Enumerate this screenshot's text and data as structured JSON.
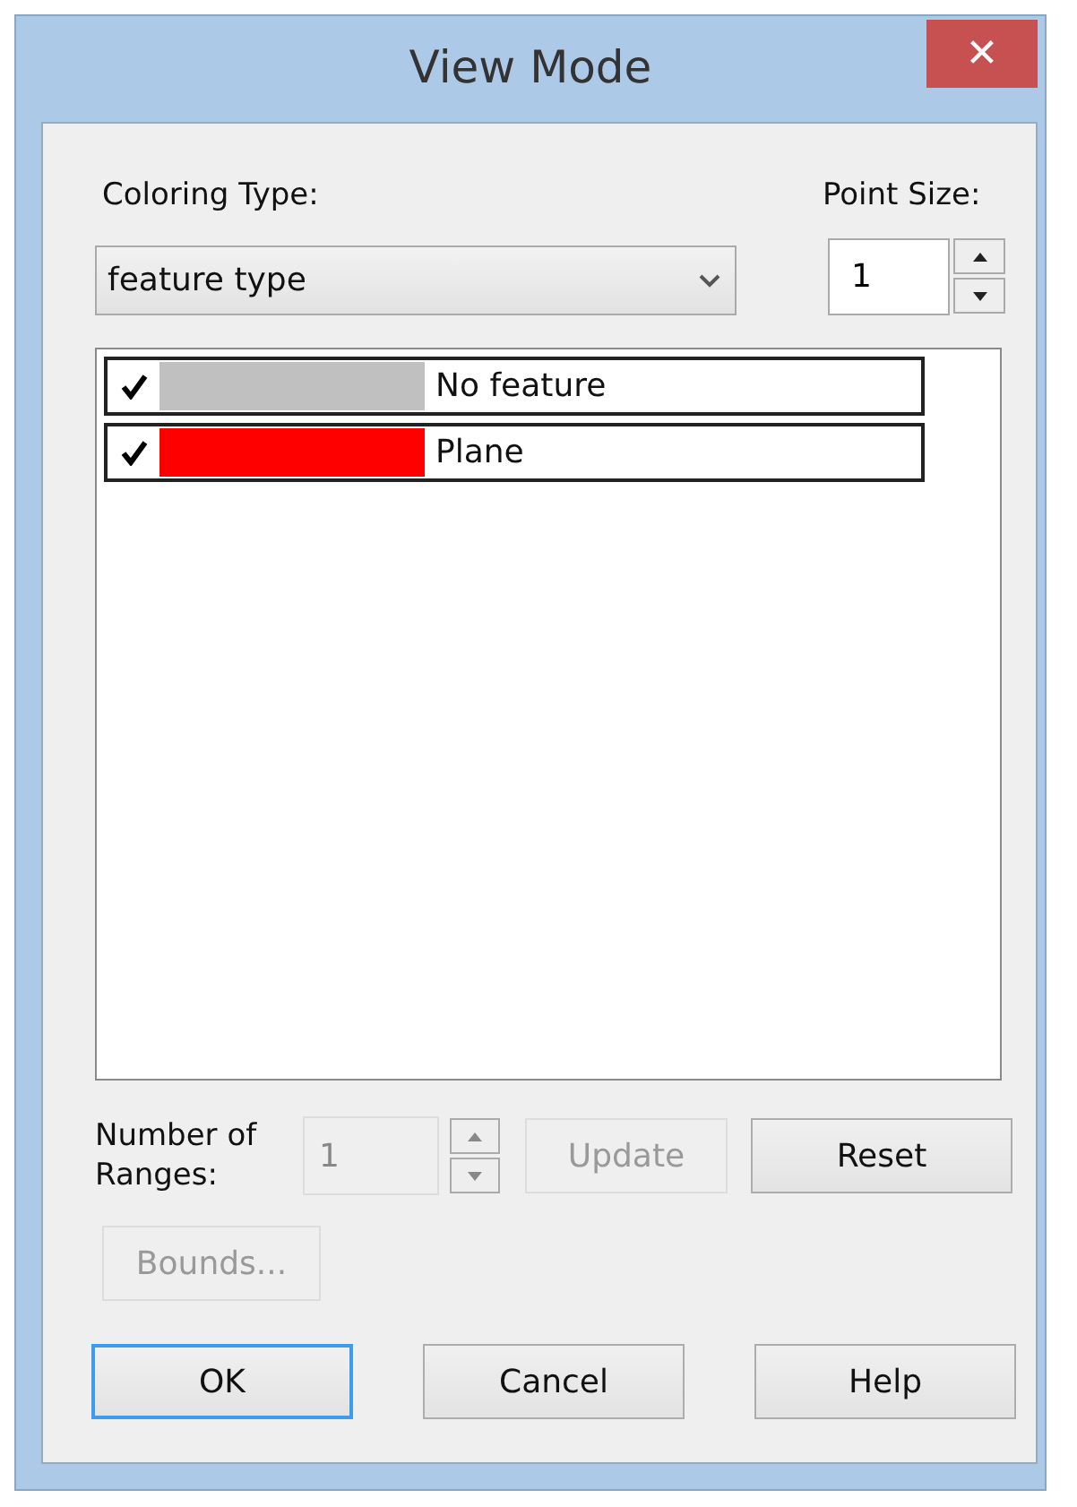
{
  "window": {
    "title": "View Mode",
    "close": "✕"
  },
  "coloring_type": {
    "label": "Coloring Type:",
    "value": "feature type"
  },
  "point_size": {
    "label": "Point Size:",
    "value": "1"
  },
  "features": [
    {
      "label": "No feature",
      "checked": true,
      "color": "#c0c0c0"
    },
    {
      "label": "Plane",
      "checked": true,
      "color": "#ff0000"
    }
  ],
  "ranges": {
    "label": "Number of Ranges:",
    "value": "1",
    "disabled": true
  },
  "range_buttons": [
    {
      "label": "Update",
      "disabled": true
    },
    {
      "label": "Reset",
      "disabled": false
    }
  ],
  "bounds_button": {
    "label": "Bounds...",
    "disabled": true
  },
  "buttons": [
    {
      "label": "OK",
      "focused": true
    },
    {
      "label": "Cancel",
      "focused": false
    },
    {
      "label": "Help",
      "focused": false
    }
  ]
}
